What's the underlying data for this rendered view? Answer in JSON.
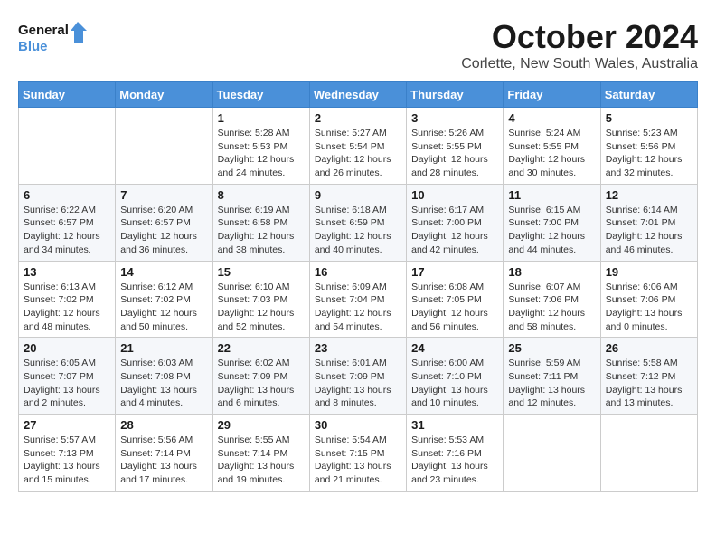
{
  "logo": {
    "line1": "General",
    "line2": "Blue"
  },
  "title": "October 2024",
  "location": "Corlette, New South Wales, Australia",
  "days_of_week": [
    "Sunday",
    "Monday",
    "Tuesday",
    "Wednesday",
    "Thursday",
    "Friday",
    "Saturday"
  ],
  "weeks": [
    [
      {
        "day": "",
        "info": ""
      },
      {
        "day": "",
        "info": ""
      },
      {
        "day": "1",
        "info": "Sunrise: 5:28 AM\nSunset: 5:53 PM\nDaylight: 12 hours\nand 24 minutes."
      },
      {
        "day": "2",
        "info": "Sunrise: 5:27 AM\nSunset: 5:54 PM\nDaylight: 12 hours\nand 26 minutes."
      },
      {
        "day": "3",
        "info": "Sunrise: 5:26 AM\nSunset: 5:55 PM\nDaylight: 12 hours\nand 28 minutes."
      },
      {
        "day": "4",
        "info": "Sunrise: 5:24 AM\nSunset: 5:55 PM\nDaylight: 12 hours\nand 30 minutes."
      },
      {
        "day": "5",
        "info": "Sunrise: 5:23 AM\nSunset: 5:56 PM\nDaylight: 12 hours\nand 32 minutes."
      }
    ],
    [
      {
        "day": "6",
        "info": "Sunrise: 6:22 AM\nSunset: 6:57 PM\nDaylight: 12 hours\nand 34 minutes."
      },
      {
        "day": "7",
        "info": "Sunrise: 6:20 AM\nSunset: 6:57 PM\nDaylight: 12 hours\nand 36 minutes."
      },
      {
        "day": "8",
        "info": "Sunrise: 6:19 AM\nSunset: 6:58 PM\nDaylight: 12 hours\nand 38 minutes."
      },
      {
        "day": "9",
        "info": "Sunrise: 6:18 AM\nSunset: 6:59 PM\nDaylight: 12 hours\nand 40 minutes."
      },
      {
        "day": "10",
        "info": "Sunrise: 6:17 AM\nSunset: 7:00 PM\nDaylight: 12 hours\nand 42 minutes."
      },
      {
        "day": "11",
        "info": "Sunrise: 6:15 AM\nSunset: 7:00 PM\nDaylight: 12 hours\nand 44 minutes."
      },
      {
        "day": "12",
        "info": "Sunrise: 6:14 AM\nSunset: 7:01 PM\nDaylight: 12 hours\nand 46 minutes."
      }
    ],
    [
      {
        "day": "13",
        "info": "Sunrise: 6:13 AM\nSunset: 7:02 PM\nDaylight: 12 hours\nand 48 minutes."
      },
      {
        "day": "14",
        "info": "Sunrise: 6:12 AM\nSunset: 7:02 PM\nDaylight: 12 hours\nand 50 minutes."
      },
      {
        "day": "15",
        "info": "Sunrise: 6:10 AM\nSunset: 7:03 PM\nDaylight: 12 hours\nand 52 minutes."
      },
      {
        "day": "16",
        "info": "Sunrise: 6:09 AM\nSunset: 7:04 PM\nDaylight: 12 hours\nand 54 minutes."
      },
      {
        "day": "17",
        "info": "Sunrise: 6:08 AM\nSunset: 7:05 PM\nDaylight: 12 hours\nand 56 minutes."
      },
      {
        "day": "18",
        "info": "Sunrise: 6:07 AM\nSunset: 7:06 PM\nDaylight: 12 hours\nand 58 minutes."
      },
      {
        "day": "19",
        "info": "Sunrise: 6:06 AM\nSunset: 7:06 PM\nDaylight: 13 hours\nand 0 minutes."
      }
    ],
    [
      {
        "day": "20",
        "info": "Sunrise: 6:05 AM\nSunset: 7:07 PM\nDaylight: 13 hours\nand 2 minutes."
      },
      {
        "day": "21",
        "info": "Sunrise: 6:03 AM\nSunset: 7:08 PM\nDaylight: 13 hours\nand 4 minutes."
      },
      {
        "day": "22",
        "info": "Sunrise: 6:02 AM\nSunset: 7:09 PM\nDaylight: 13 hours\nand 6 minutes."
      },
      {
        "day": "23",
        "info": "Sunrise: 6:01 AM\nSunset: 7:09 PM\nDaylight: 13 hours\nand 8 minutes."
      },
      {
        "day": "24",
        "info": "Sunrise: 6:00 AM\nSunset: 7:10 PM\nDaylight: 13 hours\nand 10 minutes."
      },
      {
        "day": "25",
        "info": "Sunrise: 5:59 AM\nSunset: 7:11 PM\nDaylight: 13 hours\nand 12 minutes."
      },
      {
        "day": "26",
        "info": "Sunrise: 5:58 AM\nSunset: 7:12 PM\nDaylight: 13 hours\nand 13 minutes."
      }
    ],
    [
      {
        "day": "27",
        "info": "Sunrise: 5:57 AM\nSunset: 7:13 PM\nDaylight: 13 hours\nand 15 minutes."
      },
      {
        "day": "28",
        "info": "Sunrise: 5:56 AM\nSunset: 7:14 PM\nDaylight: 13 hours\nand 17 minutes."
      },
      {
        "day": "29",
        "info": "Sunrise: 5:55 AM\nSunset: 7:14 PM\nDaylight: 13 hours\nand 19 minutes."
      },
      {
        "day": "30",
        "info": "Sunrise: 5:54 AM\nSunset: 7:15 PM\nDaylight: 13 hours\nand 21 minutes."
      },
      {
        "day": "31",
        "info": "Sunrise: 5:53 AM\nSunset: 7:16 PM\nDaylight: 13 hours\nand 23 minutes."
      },
      {
        "day": "",
        "info": ""
      },
      {
        "day": "",
        "info": ""
      }
    ]
  ]
}
